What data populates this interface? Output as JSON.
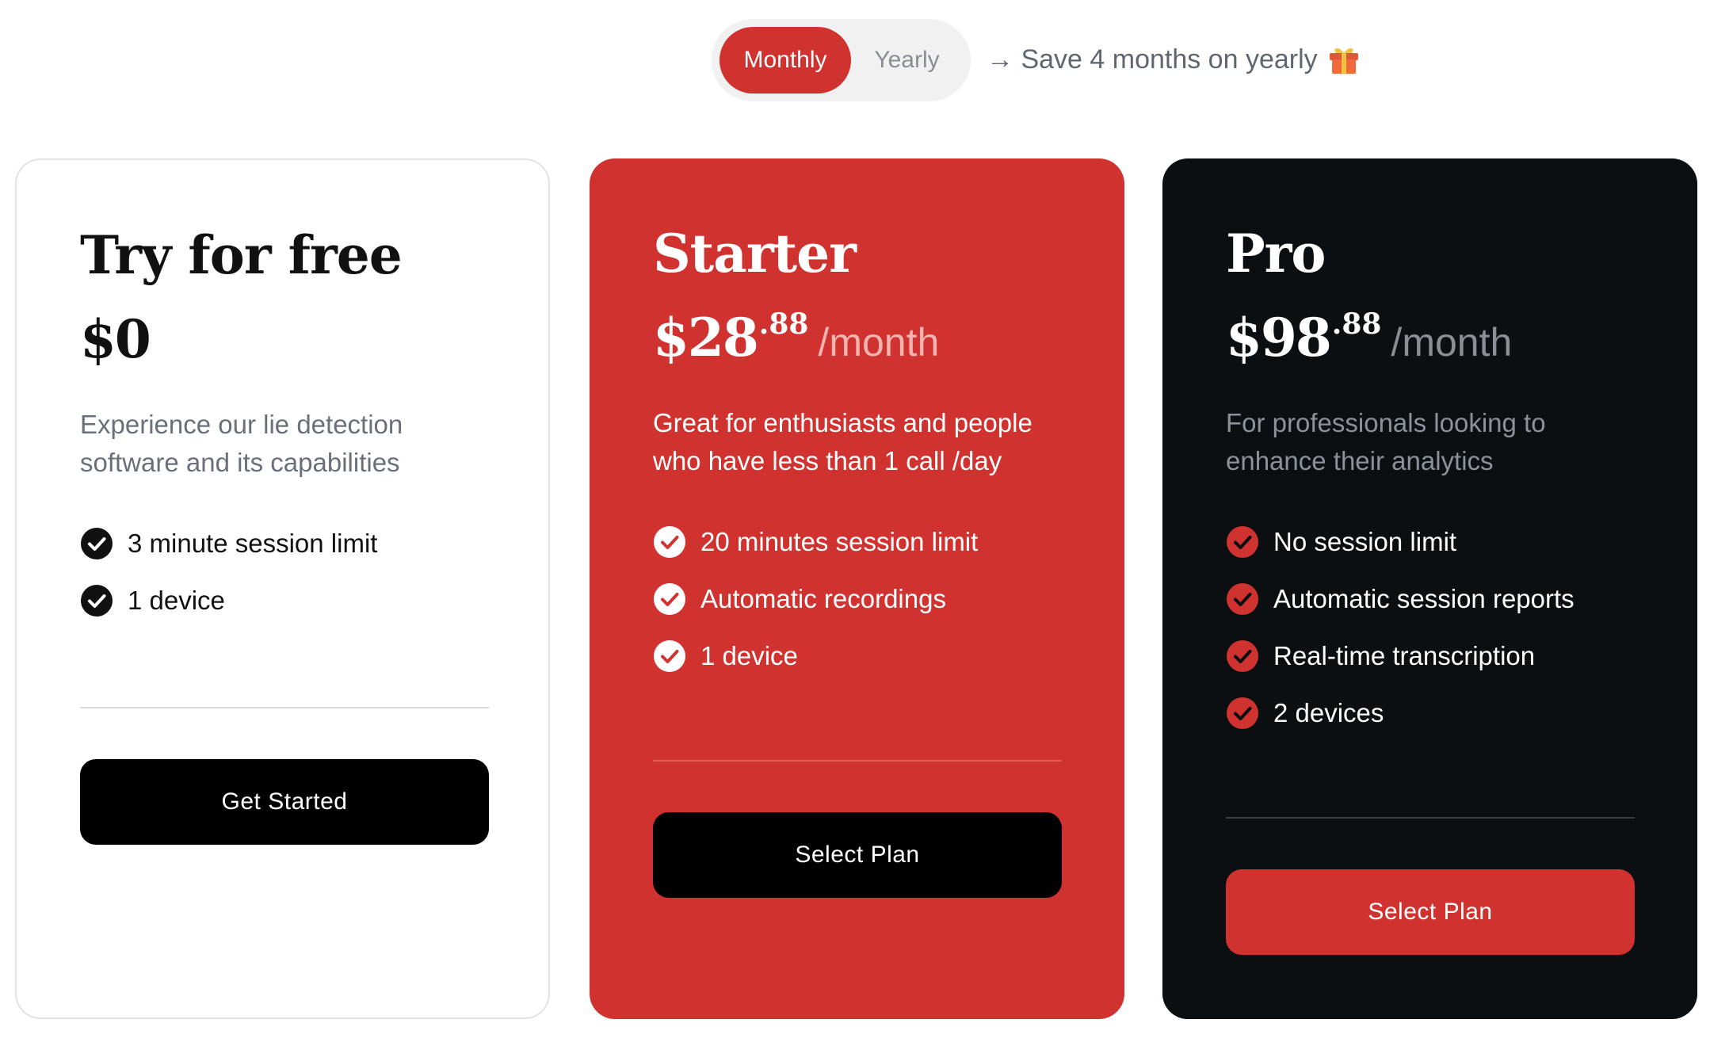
{
  "billing_toggle": {
    "monthly_label": "Monthly",
    "yearly_label": "Yearly",
    "selected": "Monthly"
  },
  "save_note": {
    "text": "→ Save 4 months on yearly",
    "icon": "gift-icon"
  },
  "colors": {
    "accent": "#d0322f",
    "dark": "#0b0f12",
    "button_dark": "#000000"
  },
  "plans": [
    {
      "name": "Try for free",
      "price": "$0",
      "cents": "",
      "period": "",
      "description": "Experience our lie detection software and its capabilities",
      "features": [
        "3 minute session limit",
        "1 device"
      ],
      "cta": "Get Started"
    },
    {
      "name": "Starter",
      "price": "$28",
      "cents": ".88",
      "period": "/month",
      "description": "Great for enthusiasts and people who have less than 1 call /day",
      "features": [
        "20 minutes session limit",
        "Automatic recordings",
        "1 device"
      ],
      "cta": "Select Plan"
    },
    {
      "name": "Pro",
      "price": "$98",
      "cents": ".88",
      "period": "/month",
      "description": "For professionals looking to enhance their analytics",
      "features": [
        "No session limit",
        "Automatic session reports",
        "Real-time transcription",
        "2 devices"
      ],
      "cta": "Select Plan"
    }
  ]
}
